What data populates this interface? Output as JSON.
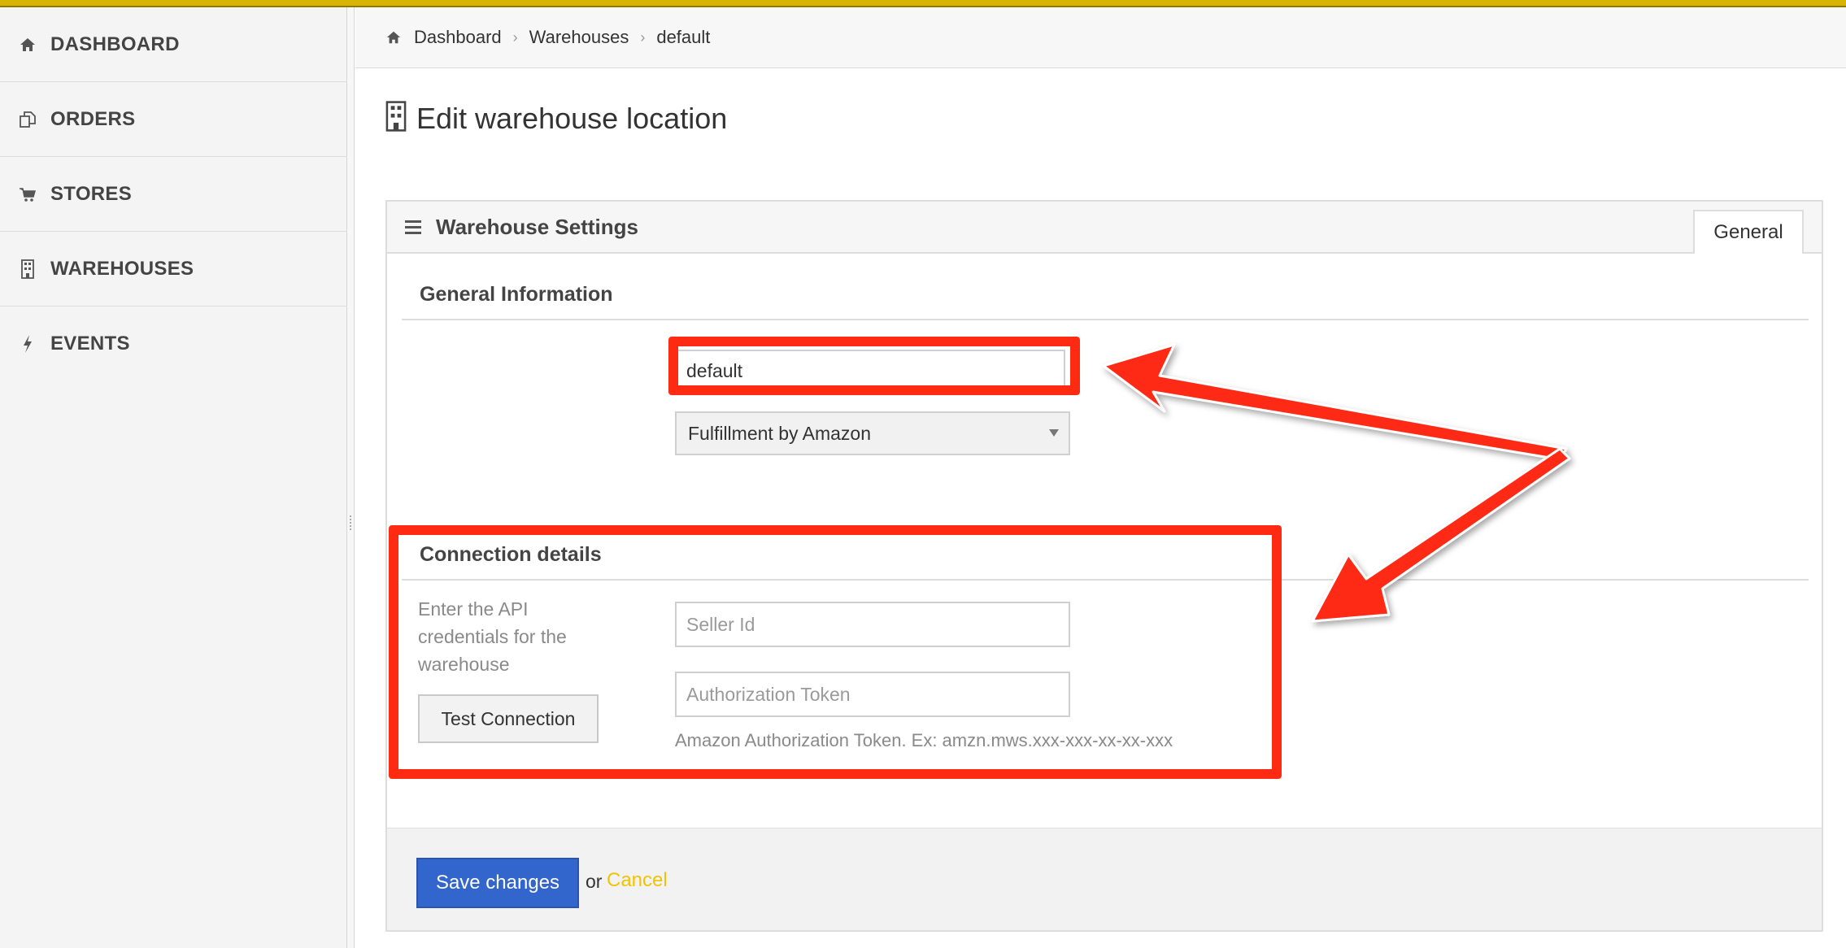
{
  "sidebar": {
    "items": [
      {
        "label": "DASHBOARD",
        "icon": "home-icon"
      },
      {
        "label": "ORDERS",
        "icon": "copy-icon"
      },
      {
        "label": "STORES",
        "icon": "cart-icon"
      },
      {
        "label": "WAREHOUSES",
        "icon": "building-icon"
      },
      {
        "label": "EVENTS",
        "icon": "bolt-icon"
      }
    ]
  },
  "breadcrumb": [
    "Dashboard",
    "Warehouses",
    "default"
  ],
  "page": {
    "title": "Edit warehouse location",
    "title_icon": "building-icon"
  },
  "panel": {
    "title": "Warehouse Settings",
    "tab": "General",
    "general": {
      "section_title": "General Information",
      "name_value": "default",
      "type_selected": "Fulfillment by Amazon"
    },
    "connection": {
      "section_title": "Connection details",
      "help": "Enter the API credentials for the warehouse",
      "seller_placeholder": "Seller Id",
      "token_placeholder": "Authorization Token",
      "token_hint": "Amazon Authorization Token. Ex: amzn.mws.xxx-xxx-xx-xx-xxx",
      "test_button": "Test Connection"
    },
    "footer": {
      "save_label": "Save changes",
      "or_text": "or",
      "cancel_label": "Cancel"
    }
  },
  "colors": {
    "accent_bar": "#d8b600",
    "primary_button": "#3366cc",
    "cancel_link": "#f2c300",
    "annotation": "#ff2a12"
  }
}
